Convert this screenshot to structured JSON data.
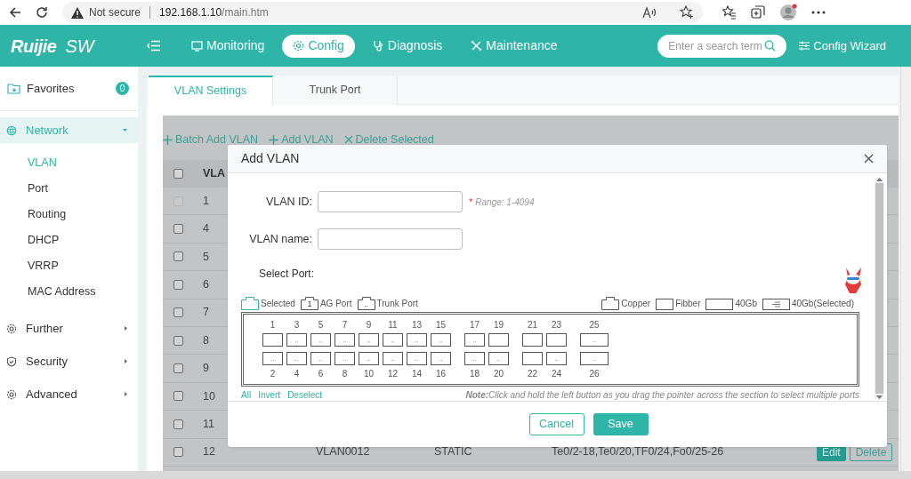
{
  "browser": {
    "security": "Not secure",
    "url_host": "192.168.1.10",
    "url_path": "/main.htm"
  },
  "header": {
    "logo": "Ruijie",
    "product": "SW",
    "nav": [
      {
        "label": "Monitoring",
        "selected": false
      },
      {
        "label": "Config",
        "selected": true
      },
      {
        "label": "Diagnosis",
        "selected": false
      },
      {
        "label": "Maintenance",
        "selected": false
      }
    ],
    "search": {
      "placeholder": "Enter a search term"
    },
    "wizard": "Config Wizard"
  },
  "sidebar": {
    "favorites": {
      "label": "Favorites",
      "count": "0"
    },
    "items": [
      {
        "label": "Network",
        "selected": true,
        "expanded": true,
        "children": [
          {
            "label": "VLAN",
            "selected": true
          },
          {
            "label": "Port",
            "selected": false
          },
          {
            "label": "Routing",
            "selected": false
          },
          {
            "label": "DHCP",
            "selected": false
          },
          {
            "label": "VRRP",
            "selected": false
          },
          {
            "label": "MAC Address",
            "selected": false
          }
        ]
      },
      {
        "label": "Further",
        "selected": false,
        "expanded": false
      },
      {
        "label": "Security",
        "selected": false,
        "expanded": false
      },
      {
        "label": "Advanced",
        "selected": false,
        "expanded": false
      }
    ]
  },
  "tabs": [
    {
      "label": "VLAN Settings",
      "selected": true
    },
    {
      "label": "Trunk Port",
      "selected": false
    }
  ],
  "toolbar": [
    {
      "label": "Batch Add VLAN",
      "kind": "add"
    },
    {
      "label": "Add VLAN",
      "kind": "add"
    },
    {
      "label": "Delete Selected",
      "kind": "delete"
    }
  ],
  "table": {
    "columns": [
      "VLA"
    ],
    "header_checked": false,
    "rows": [
      {
        "cells": [
          "1"
        ],
        "checked": false,
        "disabled": true
      },
      {
        "cells": [
          "4"
        ],
        "checked": false,
        "disabled": false
      },
      {
        "cells": [
          "5"
        ],
        "checked": false,
        "disabled": false
      },
      {
        "cells": [
          "6"
        ],
        "checked": false,
        "disabled": false
      },
      {
        "cells": [
          "7"
        ],
        "checked": false,
        "disabled": false
      },
      {
        "cells": [
          "8"
        ],
        "checked": false,
        "disabled": false
      },
      {
        "cells": [
          "9"
        ],
        "checked": false,
        "disabled": false
      },
      {
        "cells": [
          "10"
        ],
        "checked": false,
        "disabled": false
      },
      {
        "cells": [
          "11"
        ],
        "checked": false,
        "disabled": false
      },
      {
        "cells": [
          "12",
          "VLAN0012",
          "STATIC",
          "Te0/2-18,Te0/20,TF0/24,Fo0/25-26"
        ],
        "checked": false,
        "disabled": false,
        "actions": [
          "Edit",
          "Delete"
        ]
      }
    ]
  },
  "dialog": {
    "title": "Add VLAN",
    "fields": [
      {
        "label": "VLAN ID:",
        "marker": "*",
        "hint": "Range: 1-4094"
      },
      {
        "label": "VLAN name:"
      }
    ],
    "select_label": "Select Port:",
    "legend_left": [
      {
        "kind": "selected",
        "label": "Selected"
      },
      {
        "kind": "ag",
        "mark": "1",
        "label": "AG Port"
      },
      {
        "kind": "trunk",
        "mark": "..",
        "label": "Trunk Port"
      }
    ],
    "legend_right": [
      {
        "kind": "copper",
        "label": "Copper"
      },
      {
        "kind": "fiber",
        "label": "Fibber"
      },
      {
        "kind": "wide",
        "label": "40Gb"
      },
      {
        "kind": "wideselected",
        "label": "40Gb(Selected)"
      }
    ],
    "port_groups": [
      {
        "kind": "copper",
        "top": [
          {
            "number": "1"
          },
          {
            "number": "3",
            "mark": ".."
          },
          {
            "number": "5",
            "mark": ".."
          },
          {
            "number": "7",
            "mark": ".."
          },
          {
            "number": "9",
            "mark": ".."
          },
          {
            "number": "11",
            "mark": ".."
          },
          {
            "number": "13",
            "mark": ".."
          },
          {
            "number": "15",
            "mark": ".."
          }
        ],
        "bottom": [
          {
            "number": "2",
            "mark": ".."
          },
          {
            "number": "4",
            "mark": ".."
          },
          {
            "number": "6",
            "mark": ".."
          },
          {
            "number": "8",
            "mark": ".."
          },
          {
            "number": "10",
            "mark": ".."
          },
          {
            "number": "12",
            "mark": ".."
          },
          {
            "number": "14",
            "mark": ".."
          },
          {
            "number": "16",
            "mark": ".."
          }
        ]
      },
      {
        "kind": "fiber",
        "top": [
          {
            "number": "17",
            "mark": ".."
          },
          {
            "number": "19"
          }
        ],
        "bottom": [
          {
            "number": "18",
            "mark": ".."
          },
          {
            "number": "20",
            "mark": ".."
          }
        ]
      },
      {
        "kind": "fiber",
        "top": [
          {
            "number": "21"
          },
          {
            "number": "23"
          }
        ],
        "bottom": [
          {
            "number": "22"
          },
          {
            "number": "24",
            "mark": ".."
          }
        ]
      },
      {
        "kind": "wide",
        "top": [
          {
            "number": "25",
            "mark": ".."
          }
        ],
        "bottom": [
          {
            "number": "26",
            "mark": ".."
          }
        ]
      }
    ],
    "links": [
      "All",
      "Invert",
      "Deselect"
    ],
    "note": {
      "title": "Note:",
      "text": "Click and hold the left button as you drag the pointer across the section to select multiple ports"
    },
    "buttons": [
      {
        "label": "Cancel",
        "kind": "secondary"
      },
      {
        "label": "Save",
        "kind": "primary"
      }
    ]
  }
}
